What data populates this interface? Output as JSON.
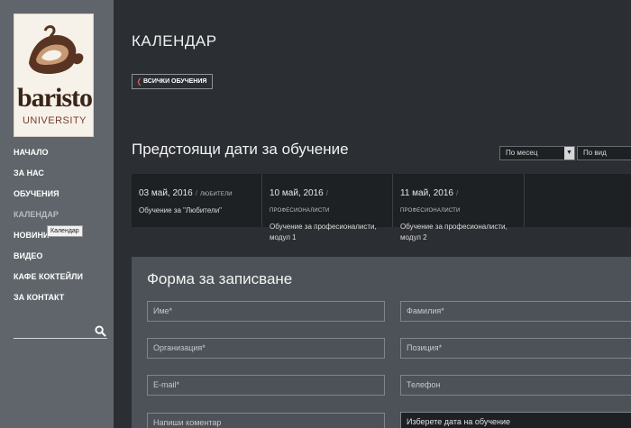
{
  "brand": {
    "line1": "baristo",
    "line2": "UNIVERSITY"
  },
  "nav": {
    "items": [
      {
        "label": "НАЧАЛО"
      },
      {
        "label": "ЗА НАС"
      },
      {
        "label": "ОБУЧЕНИЯ"
      },
      {
        "label": "КАЛЕНДАР"
      },
      {
        "label": "НОВИНИ"
      },
      {
        "label": "ВИДЕО"
      },
      {
        "label": "КАФЕ КОКТЕЙЛИ"
      },
      {
        "label": "ЗА КОНТАКТ"
      }
    ],
    "tooltip": "Календар"
  },
  "search": {
    "placeholder": ""
  },
  "page": {
    "title": "КАЛЕНДАР",
    "all_trainings": "ВСИЧКИ ОБУЧЕНИЯ"
  },
  "upcoming": {
    "title": "Предстоящи дати за обучение",
    "filter_month": "По месец",
    "filter_type": "По вид",
    "events": [
      {
        "date": "03 май, 2016",
        "tag": "ЛЮБИТЕЛИ",
        "desc": "Обучение за \"Любители\""
      },
      {
        "date": "10 май, 2016",
        "tag": "ПРОФЕСИОНАЛИСТИ",
        "desc": "Обучение за професионалисти, модул 1"
      },
      {
        "date": "11 май, 2016",
        "tag": "ПРОФЕСИОНАЛИСТИ",
        "desc": "Обучение за професионалисти, модул 2"
      }
    ]
  },
  "form": {
    "title": "Форма за записване",
    "first_name": "Име*",
    "last_name": "Фамилия*",
    "organization": "Организация*",
    "position": "Позиция*",
    "email": "E-mail*",
    "phone": "Телефон",
    "comment": "Напиши коментар",
    "date_select": "Изберете дата на обучение"
  },
  "colors": {
    "background": "#2b2e33",
    "sidebar": "#5f656b",
    "panel": "#4c5257",
    "accent": "#d45a5a"
  }
}
